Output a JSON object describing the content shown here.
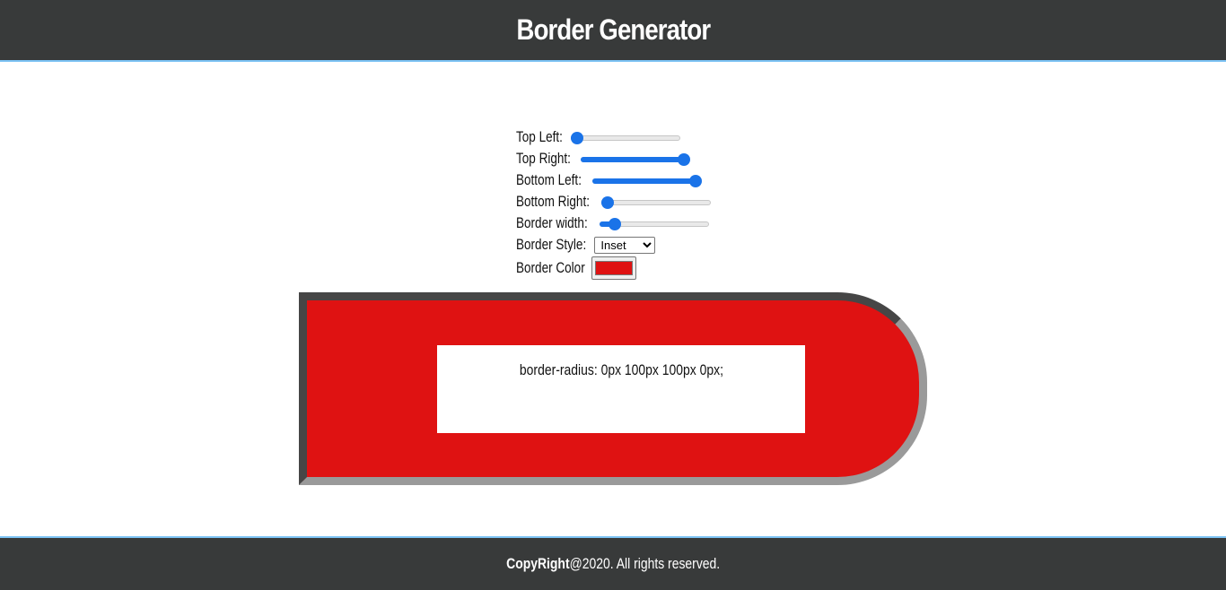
{
  "header": {
    "title": "Border Generator"
  },
  "controls": {
    "top_left": {
      "label": "Top Left:",
      "value": 0,
      "max": 100
    },
    "top_right": {
      "label": "Top Right:",
      "value": 100,
      "max": 100
    },
    "bottom_left": {
      "label": "Bottom Left:",
      "value": 100,
      "max": 100
    },
    "bottom_right": {
      "label": "Bottom Right:",
      "value": 0,
      "max": 100
    },
    "border_width": {
      "label": "Border width:",
      "value": 9,
      "max": 100
    },
    "border_style": {
      "label": "Border Style:",
      "selected": "Inset"
    },
    "border_color": {
      "label": "Border Color",
      "value": "#df1212"
    }
  },
  "preview": {
    "css_text": "border-radius: 0px 100px 100px 0px;",
    "background_color": "#df1212",
    "border_color": "#9a9a9a"
  },
  "footer": {
    "brand": "CopyRight",
    "text": "@2020. All rights reserved."
  }
}
